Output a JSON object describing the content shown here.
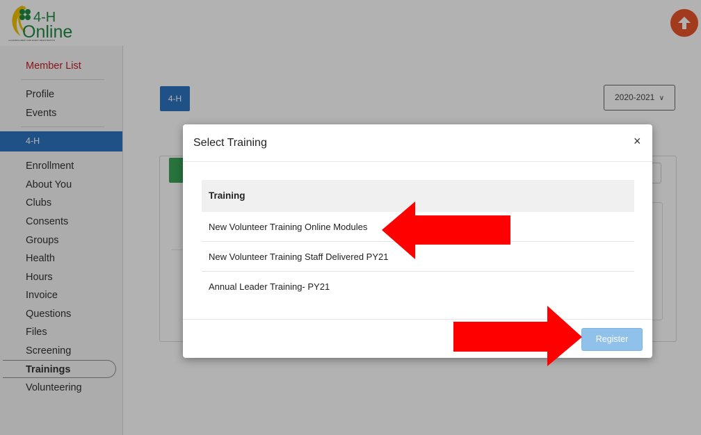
{
  "header": {
    "logo_top": "4-H",
    "logo_bottom": "Online",
    "logo_tagline": "4-H ENROLLMENT AND EVENT REGISTRATION"
  },
  "sidebar": {
    "member_list": "Member List",
    "items_top": [
      "Profile",
      "Events"
    ],
    "active": "4-H",
    "items": [
      "Enrollment",
      "About You",
      "Clubs",
      "Consents",
      "Groups",
      "Health",
      "Hours",
      "Invoice",
      "Questions",
      "Files",
      "Screening",
      "Trainings",
      "Volunteering"
    ]
  },
  "main": {
    "program_button": "4-H",
    "year_select": "2020-2021"
  },
  "modal": {
    "title": "Select Training",
    "close": "×",
    "table_header": "Training",
    "rows": [
      "New Volunteer Training Online Modules",
      "New Volunteer Training Staff Delivered PY21",
      "Annual Leader Training- PY21"
    ],
    "register_label": "Register"
  },
  "icons": {
    "upload": "upload-arrow-icon",
    "clover": "four-leaf-clover-icon"
  },
  "colors": {
    "primary_blue": "#2f74c0",
    "accent_red": "#c41e2a",
    "arrow_red": "#ff0000",
    "register_disabled": "#8fc1ea",
    "green": "#3aa55a",
    "logo_green": "#1f8b43"
  }
}
